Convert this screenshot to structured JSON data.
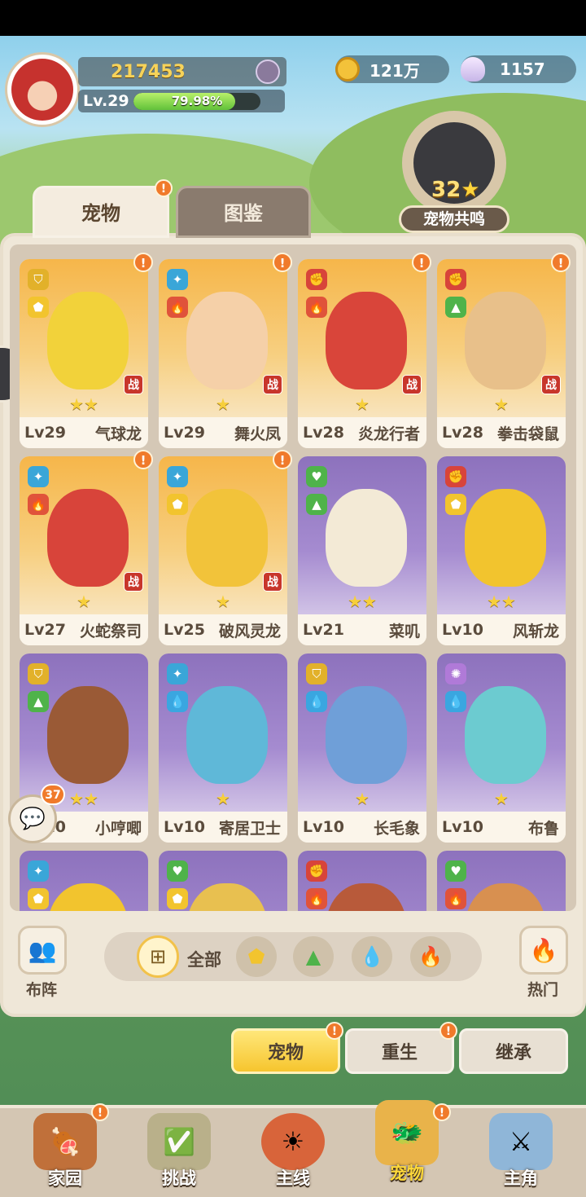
{
  "header": {
    "power": "217453",
    "level": "Lv.29",
    "exp_percent_text": "79.98%",
    "exp_fraction": 0.7998,
    "gold": "121万",
    "shells": "1157"
  },
  "resonance": {
    "count": "32",
    "star": "★",
    "label": "宠物共鸣"
  },
  "tabs": [
    {
      "label": "宠物",
      "badge": "!"
    },
    {
      "label": "图鉴"
    }
  ],
  "pets": [
    {
      "level": "Lv29",
      "name": "气球龙",
      "stars": "★★",
      "theme": "orange",
      "battle": "战",
      "badge": "!",
      "color": "#f2d23a",
      "elements": [
        "shield-icon",
        "rock-icon"
      ]
    },
    {
      "level": "Lv29",
      "name": "舞火凤",
      "stars": "★",
      "theme": "orange",
      "battle": "战",
      "badge": "!",
      "color": "#f5d0a8",
      "elements": [
        "wind-icon",
        "fire-icon"
      ]
    },
    {
      "level": "Lv28",
      "name": "炎龙行者",
      "stars": "★",
      "theme": "orange",
      "battle": "战",
      "badge": "!",
      "color": "#d9453a",
      "elements": [
        "attack-icon",
        "fire-icon"
      ]
    },
    {
      "level": "Lv28",
      "name": "拳击袋鼠",
      "stars": "★",
      "theme": "orange",
      "battle": "战",
      "badge": "!",
      "color": "#e8c08a",
      "elements": [
        "attack-icon",
        "grass-icon"
      ]
    },
    {
      "level": "Lv27",
      "name": "火蛇祭司",
      "stars": "★",
      "theme": "orange",
      "battle": "战",
      "badge": "!",
      "color": "#d8443a",
      "elements": [
        "wind-icon",
        "fire-icon"
      ]
    },
    {
      "level": "Lv25",
      "name": "破风灵龙",
      "stars": "★",
      "theme": "orange",
      "battle": "战",
      "badge": "!",
      "color": "#f2c33a",
      "elements": [
        "wind-icon",
        "rock-icon"
      ]
    },
    {
      "level": "Lv21",
      "name": "菜叽",
      "stars": "★★",
      "theme": "purple",
      "battle": "",
      "badge": "",
      "color": "#f3ead6",
      "elements": [
        "heart-icon",
        "grass-icon"
      ]
    },
    {
      "level": "Lv10",
      "name": "风斩龙",
      "stars": "★★",
      "theme": "purple",
      "battle": "",
      "badge": "",
      "color": "#f2c42e",
      "elements": [
        "attack-icon",
        "rock-icon"
      ]
    },
    {
      "level": "Lv10",
      "name": "小哼唧",
      "stars": "★★",
      "theme": "purple",
      "battle": "",
      "badge": "",
      "color": "#9a5a36",
      "elements": [
        "shield-icon",
        "grass-icon"
      ]
    },
    {
      "level": "Lv10",
      "name": "寄居卫士",
      "stars": "★",
      "theme": "purple",
      "battle": "",
      "badge": "",
      "color": "#5fb8d8",
      "elements": [
        "wind-icon",
        "water-icon"
      ]
    },
    {
      "level": "Lv10",
      "name": "长毛象",
      "stars": "★",
      "theme": "purple",
      "battle": "",
      "badge": "",
      "color": "#6f9fd8",
      "elements": [
        "shield-icon",
        "water-icon"
      ]
    },
    {
      "level": "Lv10",
      "name": "布鲁",
      "stars": "★",
      "theme": "purple",
      "battle": "",
      "badge": "",
      "color": "#6ccbd0",
      "elements": [
        "magic-icon",
        "water-icon"
      ]
    },
    {
      "level": "",
      "name": "",
      "stars": "",
      "theme": "purple",
      "battle": "",
      "badge": "",
      "color": "#f2c42e",
      "elements": [
        "wind-icon",
        "rock-icon"
      ]
    },
    {
      "level": "",
      "name": "",
      "stars": "",
      "theme": "purple",
      "battle": "",
      "badge": "",
      "color": "#e8c050",
      "elements": [
        "heart-icon",
        "rock-icon"
      ]
    },
    {
      "level": "",
      "name": "",
      "stars": "",
      "theme": "purple",
      "battle": "",
      "badge": "",
      "color": "#b85a3a",
      "elements": [
        "attack-icon",
        "fire-icon"
      ]
    },
    {
      "level": "",
      "name": "",
      "stars": "",
      "theme": "purple",
      "battle": "",
      "badge": "",
      "color": "#d89050",
      "elements": [
        "heart-icon",
        "fire-icon"
      ]
    }
  ],
  "chat": {
    "count": "37"
  },
  "filters": {
    "formation_label": "布阵",
    "all_label": "全部",
    "hot_label": "热门",
    "items": [
      "rock-icon",
      "grass-icon",
      "water-icon",
      "fire-icon"
    ]
  },
  "actions": [
    {
      "label": "宠物",
      "badge": ""
    },
    {
      "label": "重生",
      "badge": "!"
    },
    {
      "label": "继承",
      "badge": ""
    }
  ],
  "action_badge_first": "!",
  "nav": [
    {
      "label": "家园",
      "badge": "!"
    },
    {
      "label": "挑战",
      "badge": ""
    },
    {
      "label": "主线",
      "badge": ""
    },
    {
      "label": "宠物",
      "badge": "!"
    },
    {
      "label": "主角",
      "badge": ""
    }
  ],
  "colors": {
    "accent": "#f6c52e",
    "badge": "#f07a2b",
    "panel": "#efe7d8"
  }
}
